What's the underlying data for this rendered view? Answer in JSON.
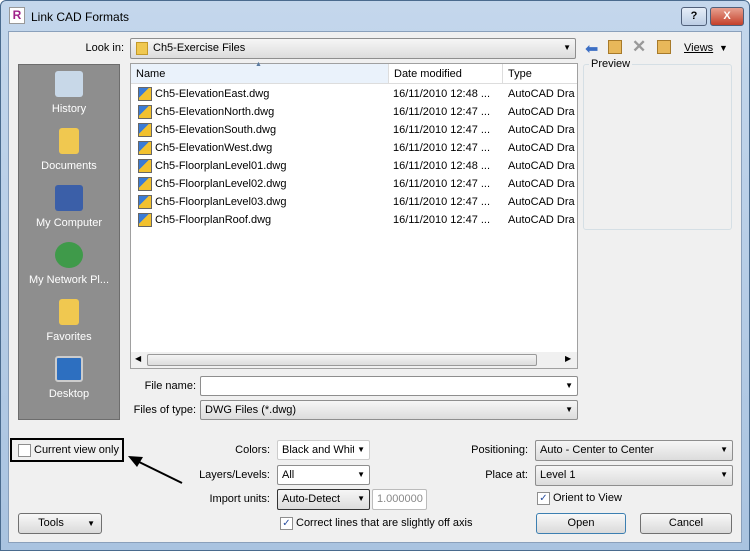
{
  "window": {
    "title": "Link CAD Formats",
    "logo": "R",
    "help_label": "?",
    "close_label": "X"
  },
  "look_in": {
    "label": "Look in:",
    "value": "Ch5-Exercise Files"
  },
  "toolbar": {
    "views_label": "Views",
    "icons": [
      "back-arrow-icon",
      "up-folder-icon",
      "delete-icon",
      "new-folder-icon"
    ]
  },
  "places": [
    {
      "label": "History",
      "icon": "history-icon"
    },
    {
      "label": "Documents",
      "icon": "documents-icon"
    },
    {
      "label": "My Computer",
      "icon": "computer-icon"
    },
    {
      "label": "My Network Pl...",
      "icon": "network-icon"
    },
    {
      "label": "Favorites",
      "icon": "favorites-icon"
    },
    {
      "label": "Desktop",
      "icon": "desktop-icon"
    }
  ],
  "file_list": {
    "columns": [
      "Name",
      "Date modified",
      "Type"
    ],
    "rows": [
      {
        "name": "Ch5-ElevationEast.dwg",
        "date": "16/11/2010 12:48 ...",
        "type": "AutoCAD Dra"
      },
      {
        "name": "Ch5-ElevationNorth.dwg",
        "date": "16/11/2010 12:47 ...",
        "type": "AutoCAD Dra"
      },
      {
        "name": "Ch5-ElevationSouth.dwg",
        "date": "16/11/2010 12:47 ...",
        "type": "AutoCAD Dra"
      },
      {
        "name": "Ch5-ElevationWest.dwg",
        "date": "16/11/2010 12:47 ...",
        "type": "AutoCAD Dra"
      },
      {
        "name": "Ch5-FloorplanLevel01.dwg",
        "date": "16/11/2010 12:48 ...",
        "type": "AutoCAD Dra"
      },
      {
        "name": "Ch5-FloorplanLevel02.dwg",
        "date": "16/11/2010 12:47 ...",
        "type": "AutoCAD Dra"
      },
      {
        "name": "Ch5-FloorplanLevel03.dwg",
        "date": "16/11/2010 12:47 ...",
        "type": "AutoCAD Dra"
      },
      {
        "name": "Ch5-FloorplanRoof.dwg",
        "date": "16/11/2010 12:47 ...",
        "type": "AutoCAD Dra"
      }
    ]
  },
  "preview": {
    "label": "Preview"
  },
  "file_name": {
    "label": "File name:",
    "value": ""
  },
  "files_of_type": {
    "label": "Files of type:",
    "value": "DWG Files  (*.dwg)"
  },
  "current_view_only": {
    "label": "Current view only",
    "checked": false
  },
  "colors": {
    "label": "Colors:",
    "value": "Black and White"
  },
  "layers": {
    "label": "Layers/Levels:",
    "value": "All"
  },
  "import_units": {
    "label": "Import units:",
    "value": "Auto-Detect",
    "factor": "1.000000"
  },
  "correct_lines": {
    "label": "Correct lines that are slightly off axis",
    "checked": true
  },
  "positioning": {
    "label": "Positioning:",
    "value": "Auto - Center to Center"
  },
  "place_at": {
    "label": "Place at:",
    "value": "Level 1"
  },
  "orient": {
    "label": "Orient to View",
    "checked": true
  },
  "buttons": {
    "tools": "Tools",
    "open": "Open",
    "cancel": "Cancel"
  }
}
